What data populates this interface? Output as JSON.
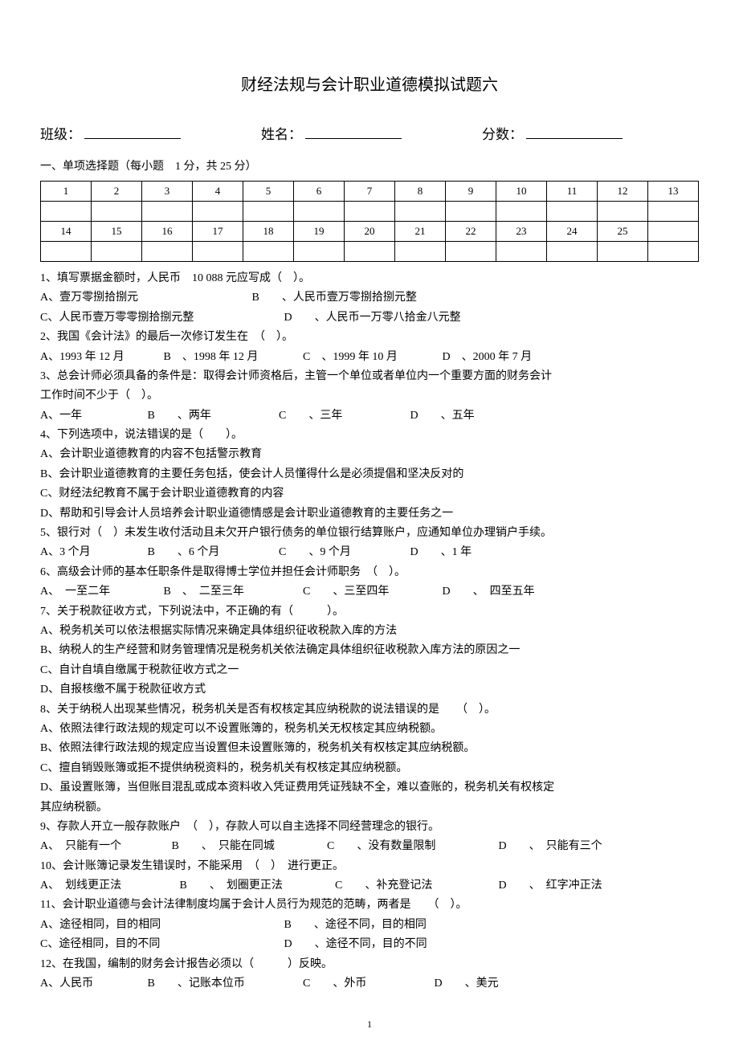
{
  "title": "财经法规与会计职业道德模拟试题六",
  "header": {
    "class_label": "班级：",
    "name_label": "姓名：",
    "score_label": "分数："
  },
  "section1": {
    "heading": "一、单项选择题（每小题　1 分，共 25 分）",
    "grid_row1": [
      "1",
      "2",
      "3",
      "4",
      "5",
      "6",
      "7",
      "8",
      "9",
      "10",
      "11",
      "12",
      "13"
    ],
    "grid_row2": [
      "14",
      "15",
      "16",
      "17",
      "18",
      "19",
      "20",
      "21",
      "22",
      "23",
      "24",
      "25",
      ""
    ]
  },
  "q1": {
    "stem": "1、填写票据金额时，人民币　10 088 元应写成（　）。",
    "A": "A、壹万零捌拾捌元",
    "B": "B　　、人民币壹万零捌拾捌元整",
    "C": "C、人民币壹万零零捌拾捌元整",
    "D": "D　　、人民币一万零八拾金八元整"
  },
  "q2": {
    "stem": "2、我国《会计法》的最后一次修订发生在　（　）。",
    "A": "A、1993 年 12 月",
    "B": "B　、1998 年 12 月",
    "C": "C　、1999 年 10 月",
    "D": "D　、2000 年 7 月"
  },
  "q3": {
    "stem1": "3、总会计师必须具备的条件是：取得会计师资格后，主管一个单位或者单位内一个重要方面的财务会计",
    "stem2": "工作时间不少于（　）。",
    "A": "A、一年",
    "B": "B　　、两年",
    "C": "C　　、三年",
    "D": "D　　、五年"
  },
  "q4": {
    "stem": "4、下列选项中，说法错误的是（　　）。",
    "A": "A、会计职业道德教育的内容不包括警示教育",
    "B": "B、会计职业道德教育的主要任务包括，使会计人员懂得什么是必须提倡和坚决反对的",
    "C": "C、财经法纪教育不属于会计职业道德教育的内容",
    "D": "D、帮助和引导会计人员培养会计职业道德情感是会计职业道德教育的主要任务之一"
  },
  "q5": {
    "stem": "5、银行对（　）未发生收付活动且未欠开户银行债务的单位银行结算账户，应通知单位办理销户手续。",
    "A": "A、3 个月",
    "B": "B　　、6 个月",
    "C": "C　　、9 个月",
    "D": "D　　、1 年"
  },
  "q6": {
    "stem": "6、高级会计师的基本任职条件是取得博士学位并担任会计师职务　（　）。",
    "A": "A、　一至二年",
    "B": "B　、　二至三年",
    "C": "C　　、三至四年",
    "D": "D　　、　四至五年"
  },
  "q7": {
    "stem": "7、关于税款征收方式，下列说法中，不正确的有（　　　）。",
    "A": "A、税务机关可以依法根据实际情况来确定具体组织征收税款入库的方法",
    "B": "B、纳税人的生产经营和财务管理情况是税务机关依法确定具体组织征收税款入库方法的原因之一",
    "C": "C、自计自填自缴属于税款征收方式之一",
    "D": "D、自报核缴不属于税款征收方式"
  },
  "q8": {
    "stem": "8、关于纳税人出现某些情况，税务机关是否有权核定其应纳税款的说法错误的是　　（　）。",
    "A": "A、依照法律行政法规的规定可以不设置账簿的，税务机关无权核定其应纳税额。",
    "B": "B、依照法律行政法规的规定应当设置但未设置账簿的，税务机关有权核定其应纳税额。",
    "C": "C、擅自销毁账簿或拒不提供纳税资料的，税务机关有权核定其应纳税额。",
    "D1": "D、虽设置账簿，当但账目混乱或成本资料收入凭证费用凭证残缺不全，难以查账的，税务机关有权核定",
    "D2": "其应纳税额。"
  },
  "q9": {
    "stem": "9、存款人开立一般存款账户　（　），存款人可以自主选择不同经营理念的银行。",
    "A": "A、　只能有一个",
    "B": "B　　、　只能在同城",
    "C": "C　　、没有数量限制",
    "D": "D　　、　只能有三个"
  },
  "q10": {
    "stem": "10、会计账簿记录发生错误时，不能采用　（　）　进行更正。",
    "A": "A、　划线更正法",
    "B": "B　　、　划圈更正法",
    "C": "C　　、补充登记法",
    "D": "D　　、　红字冲正法"
  },
  "q11": {
    "stem": "11、会计职业道德与会计法律制度均属于会计人员行为规范的范畴，两者是　　（　）。",
    "A": "A、途径相同，目的相同",
    "B": "B　　、途径不同，目的相同",
    "C": "C、途径相同，目的不同",
    "D": "D　　、途径不同，目的不同"
  },
  "q12": {
    "stem": "12、在我国，编制的财务会计报告必须以（　　　）反映。",
    "A": "A、人民币",
    "B": "B　　、记账本位币",
    "C": "C　　、外币",
    "D": "D　　、美元"
  },
  "page_number": "1"
}
